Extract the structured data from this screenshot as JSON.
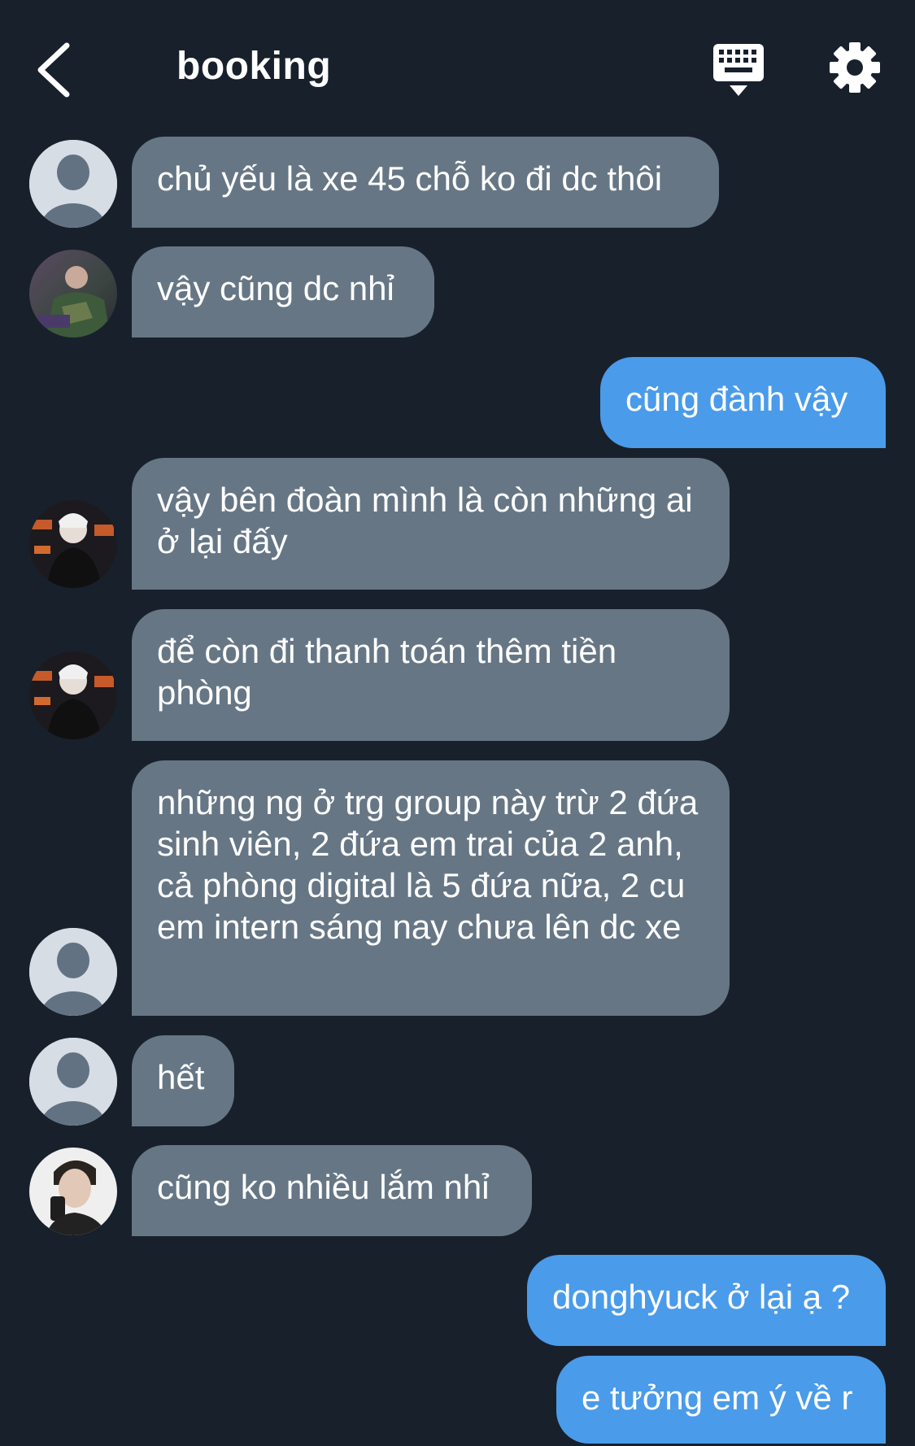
{
  "header": {
    "title": "booking",
    "back_icon": "chevron-left-icon",
    "keyboard_icon": "keyboard-icon",
    "settings_icon": "gear-icon"
  },
  "colors": {
    "background": "#18202c",
    "incoming_bubble": "#667685",
    "outgoing_bubble": "#4a9bea",
    "text": "#ffffff"
  },
  "messages": [
    {
      "direction": "in",
      "avatar": "placeholder-avatar",
      "text": "chủ yếu là xe 45 chỗ ko đi dc thôi"
    },
    {
      "direction": "in",
      "avatar": "photo-avatar-1",
      "text": "vậy cũng dc nhỉ"
    },
    {
      "direction": "out",
      "text": "cũng đành vậy"
    },
    {
      "direction": "in",
      "avatar": "photo-avatar-2",
      "text": "vậy bên đoàn mình là còn những ai ở lại đấy"
    },
    {
      "direction": "in",
      "avatar": "photo-avatar-2",
      "text": "để còn đi thanh toán thêm tiền phòng"
    },
    {
      "direction": "in",
      "avatar": "placeholder-avatar",
      "text": "những ng ở trg group này trừ 2 đứa sinh viên, 2 đứa em trai của 2 anh, cả phòng digital là 5 đứa nữa, 2 cu em intern sáng nay chưa lên dc xe"
    },
    {
      "direction": "in",
      "avatar": "placeholder-avatar",
      "text": "hết"
    },
    {
      "direction": "in",
      "avatar": "photo-avatar-3",
      "text": "cũng ko nhiều lắm nhỉ"
    },
    {
      "direction": "out",
      "text": "donghyuck ở lại ạ ?"
    },
    {
      "direction": "out",
      "text": "e tưởng em ý về r"
    }
  ]
}
